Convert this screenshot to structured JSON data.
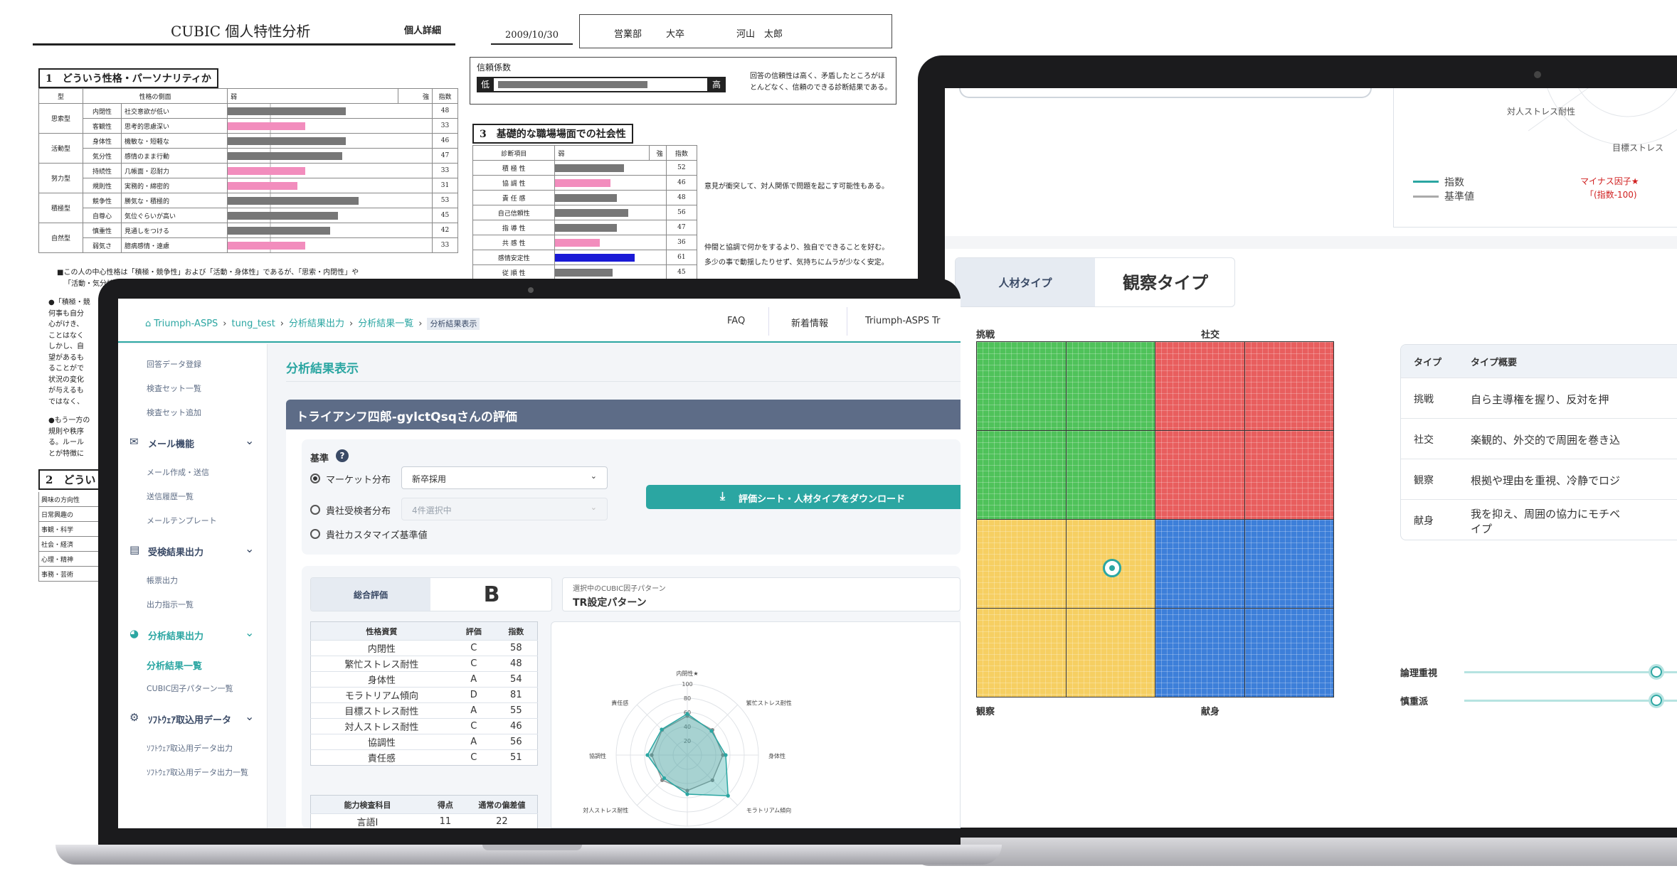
{
  "paper": {
    "title": "CUBIC 個人特性分析",
    "badge": "個人詳細",
    "date": "2009/10/30",
    "dept": "営業部",
    "edu": "大卒",
    "name": "河山　太郎",
    "section1": "1　どういう性格・パーソナリティか",
    "reliability_label": "信頼係数",
    "rel_low": "低",
    "rel_high": "高",
    "rel_note_1": "回答の信頼性は高く、矛盾したところがほ",
    "rel_note_2": "とんどなく、信頼のできる診断結果である。",
    "section3": "3　基礎的な職場場面での社会性",
    "section2": "2　どうい",
    "headers1": [
      "型",
      "性格の側面",
      "弱",
      "強",
      "指数"
    ],
    "rows1": [
      {
        "type": "思索型",
        "aspect": "内閉性",
        "desc": "社交意欲が低い",
        "value": 48,
        "bar": 0.58,
        "pink": false
      },
      {
        "type": "",
        "aspect": "客観性",
        "desc": "思考的思慮深い",
        "value": 33,
        "bar": 0.38,
        "pink": true
      },
      {
        "type": "活動型",
        "aspect": "身体性",
        "desc": "機敏な・短軽な",
        "value": 46,
        "bar": 0.58,
        "pink": false
      },
      {
        "type": "",
        "aspect": "気分性",
        "desc": "感情のまま行動",
        "value": 47,
        "bar": 0.56,
        "pink": false
      },
      {
        "type": "努力型",
        "aspect": "持続性",
        "desc": "几帳面・忍耐力",
        "value": 33,
        "bar": 0.38,
        "pink": true
      },
      {
        "type": "",
        "aspect": "規則性",
        "desc": "実務的・綿密的",
        "value": 31,
        "bar": 0.34,
        "pink": true
      },
      {
        "type": "積極型",
        "aspect": "競争性",
        "desc": "勝気な・積極的",
        "value": 53,
        "bar": 0.64,
        "pink": false
      },
      {
        "type": "",
        "aspect": "自尊心",
        "desc": "気位ぐらいが高い",
        "value": 45,
        "bar": 0.54,
        "pink": false
      },
      {
        "type": "自然型",
        "aspect": "慎重性",
        "desc": "見通しをつける",
        "value": 42,
        "bar": 0.5,
        "pink": false
      },
      {
        "type": "",
        "aspect": "弱気さ",
        "desc": "臆病感情・遠慮",
        "value": 33,
        "bar": 0.38,
        "pink": true
      }
    ],
    "note_main_1": "■この人の中心性格は「積極・競争性」および「活動・身体性」であるが、「思索・内閉性」や",
    "note_main_2": "「活動・気分性」",
    "side_notes": [
      "●「積極・競",
      "何事も自分",
      "心がけき、",
      "ことはなく",
      "しかし、自",
      "望があるも",
      "ることがで",
      "状況の変化",
      "が与えるも",
      "ではなく、"
    ],
    "side_notes2": [
      "●もう一方の",
      "規則や秩序",
      "る。ルール",
      "とが特徴に"
    ],
    "headers3": [
      "診断項目",
      "弱",
      "強",
      "指数"
    ],
    "rows3": [
      {
        "item": "積 極 性",
        "value": 52,
        "bar": 0.62,
        "c": "g"
      },
      {
        "item": "協 調 性",
        "value": 46,
        "bar": 0.5,
        "c": "p"
      },
      {
        "item": "責 任 感",
        "value": 48,
        "bar": 0.56,
        "c": "g"
      },
      {
        "item": "自己信頼性",
        "value": 56,
        "bar": 0.66,
        "c": "g"
      },
      {
        "item": "指 導 性",
        "value": 47,
        "bar": 0.56,
        "c": "g"
      },
      {
        "item": "共 感 性",
        "value": 36,
        "bar": 0.4,
        "c": "p"
      },
      {
        "item": "感情安定性",
        "value": 61,
        "bar": 0.72,
        "c": "b"
      },
      {
        "item": "従 順 性",
        "value": 45,
        "bar": 0.52,
        "c": "g"
      }
    ],
    "note3_1": "意見が衝突して、対人関係で問題を起こす可能性もある。",
    "note3_2": "仲間と協調で何かをするより、独自でできることを好む。",
    "note3_3": "多少の事で動揺したりせず、気持ちにムラが少なく安定。",
    "rows2": [
      "興味の方向性",
      "日常興趣の",
      "事観・科学",
      "社会・経済",
      "心理・精神",
      "事務・芸術"
    ]
  },
  "right": {
    "stress_label": "対人ストレス耐性",
    "target_label": "目標ストレス",
    "legend_index": "指数",
    "legend_base": "基準値",
    "minus_note_1": "マイナス因子★",
    "minus_note_2": "「(指数-100)",
    "type_tab_label": "人材タイプ",
    "type_value": "観察タイプ",
    "corner_tl": "挑戦",
    "corner_tr": "社交",
    "corner_bl": "観察",
    "corner_br": "献身",
    "table_headers": [
      "タイプ",
      "タイプ概要"
    ],
    "table_rows": [
      {
        "type": "挑戦",
        "desc": "自ら主導権を握り、反対を押"
      },
      {
        "type": "社交",
        "desc": "楽観的、外交的で周囲を巻き込"
      },
      {
        "type": "観察",
        "desc": "根拠や理由を重視、冷静でロジ"
      },
      {
        "type": "献身",
        "desc": "我を抑え、周囲の協力にモチベ"
      }
    ],
    "table_row4_line2": "イプ",
    "sliders": [
      {
        "label": "論理重視",
        "value": 0.4
      },
      {
        "label": "慎重派",
        "value": 0.4
      }
    ]
  },
  "app": {
    "breadcrumb": [
      "Triumph-ASPS",
      "tung_test",
      "分析結果出力",
      "分析結果一覧",
      "分析結果表示"
    ],
    "nav": [
      "FAQ",
      "新着情報",
      "Triumph-ASPS Tr"
    ],
    "page_title": "分析結果表示",
    "sidebar": {
      "top_items": [
        "回答データ登録",
        "検査セット一覧",
        "検査セット追加"
      ],
      "mail_header": "メール機能",
      "mail_items": [
        "メール作成・送信",
        "送信履歴一覧",
        "メールテンプレート"
      ],
      "result_header": "受検結果出力",
      "result_items": [
        "帳票出力",
        "出力指示一覧"
      ],
      "analysis_header": "分析結果出力",
      "analysis_items": [
        "分析結果一覧",
        "CUBIC因子パターン一覧"
      ],
      "software_header": "ｿﾌﾄｳｪｱ取込用データ",
      "software_items": [
        "ｿﾌﾄｳｪｱ取込用データ出力",
        "ｿﾌﾄｳｪｱ取込用データ出力一覧"
      ]
    },
    "eval_title": "トライアンフ四郎-gylctQsqさんの評価",
    "criteria_label": "基準",
    "radio_market": "マーケット分布",
    "radio_candidates": "貴社受検者分布",
    "radio_custom": "貴社カスタマイズ基準値",
    "select_market": "新卒採用",
    "select_candidates": "4件選択中",
    "download_button": "評価シート・人材タイプをダウンロード",
    "overall_label": "総合評価",
    "overall_grade": "B",
    "pattern_label": "選択中のCUBIC因子パターン",
    "pattern_value": "TR設定パターン",
    "trait_headers": [
      "性格資質",
      "評価",
      "指数"
    ],
    "traits": [
      {
        "name": "内閉性",
        "grade": "C",
        "index": 58
      },
      {
        "name": "繁忙ストレス耐性",
        "grade": "C",
        "index": 48
      },
      {
        "name": "身体性",
        "grade": "A",
        "index": 54
      },
      {
        "name": "モラトリアム傾向",
        "grade": "D",
        "index": 81
      },
      {
        "name": "目標ストレス耐性",
        "grade": "A",
        "index": 55
      },
      {
        "name": "対人ストレス耐性",
        "grade": "C",
        "index": 46
      },
      {
        "name": "協調性",
        "grade": "A",
        "index": 56
      },
      {
        "name": "責任感",
        "grade": "C",
        "index": 51
      }
    ],
    "ability_headers": [
      "能力検査科目",
      "得点",
      "通常の偏差値"
    ],
    "ability_rows": [
      {
        "subject": "言語I",
        "score": 11,
        "dev": 22
      }
    ],
    "radar_labels": [
      "内閉性★",
      "繁忙ストレス耐性",
      "身体性",
      "モラトリアム傾向",
      "目標ストレス耐性",
      "対人ストレス耐性",
      "協調性",
      "責任感"
    ],
    "radar_ticks": [
      "100",
      "80",
      "60",
      "40",
      "20"
    ]
  },
  "chart_data": {
    "type": "radar",
    "categories": [
      "内閉性",
      "繁忙ストレス耐性",
      "身体性",
      "モラトリアム傾向",
      "目標ストレス耐性",
      "対人ストレス耐性",
      "協調性",
      "責任感"
    ],
    "series": [
      {
        "name": "指数",
        "values": [
          58,
          48,
          54,
          81,
          55,
          46,
          56,
          51
        ]
      },
      {
        "name": "基準値",
        "values": [
          55,
          50,
          50,
          50,
          50,
          50,
          50,
          50
        ]
      }
    ],
    "ylim": [
      0,
      100
    ]
  },
  "colors": {
    "teal": "#2ba6a2",
    "header_bar": "#5d6c87",
    "green": "#4fc25a",
    "red": "#e85e5e",
    "yellow": "#f6cf62",
    "blue": "#3d7fd9"
  }
}
